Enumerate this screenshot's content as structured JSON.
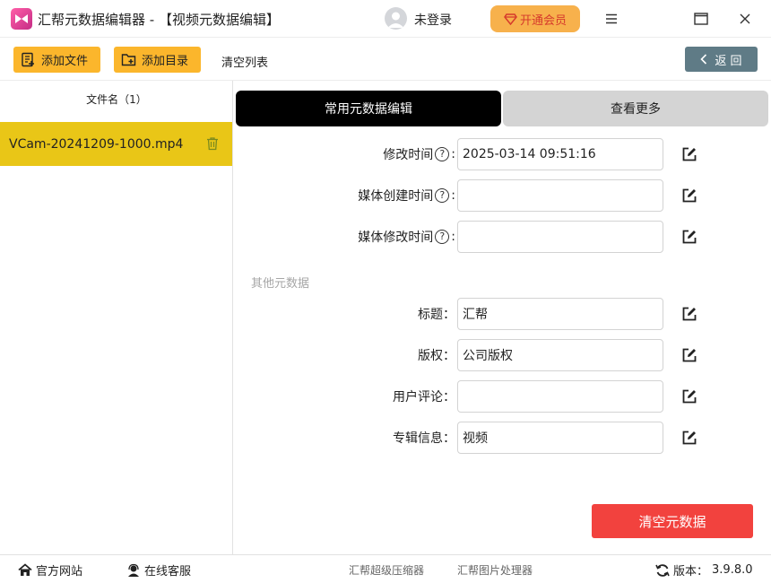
{
  "window": {
    "title": "汇帮元数据编辑器 - 【视频元数据编辑】",
    "user_label": "未登录",
    "vip_label": "开通会员"
  },
  "toolbar": {
    "add_file": "添加文件",
    "add_dir": "添加目录",
    "clear_list": "清空列表",
    "back": "返 回"
  },
  "file_list": {
    "header": "文件名（1）",
    "items": [
      {
        "name": "VCam-20241209-1000.mp4"
      }
    ]
  },
  "tabs": {
    "common": "常用元数据编辑",
    "more": "查看更多"
  },
  "fields": {
    "modified_time": {
      "label": "修改时间",
      "help": "?",
      "colon": ":",
      "value": "2025-03-14 09:51:16"
    },
    "media_created": {
      "label": "媒体创建时间",
      "help": "?",
      "colon": ":",
      "value": ""
    },
    "media_modified": {
      "label": "媒体修改时间",
      "help": "?",
      "colon": ":",
      "value": ""
    },
    "other_section": "其他元数据",
    "title": {
      "label": "标题：",
      "value": "汇帮"
    },
    "copyright": {
      "label": "版权：",
      "value": "公司版权"
    },
    "comment": {
      "label": "用户评论：",
      "value": ""
    },
    "album": {
      "label": "专辑信息：",
      "value": "视频"
    }
  },
  "actions": {
    "clear_metadata": "清空元数据"
  },
  "footer": {
    "website": "官方网站",
    "support": "在线客服",
    "compressor": "汇帮超级压缩器",
    "image_tool": "汇帮图片处理器",
    "version_label": "版本：",
    "version": "3.9.8.0"
  },
  "colors": {
    "accent_yellow": "#fbb62c",
    "selected_row": "#e9c617",
    "vip": "#f7b14c",
    "danger": "#f2423e",
    "back_button": "#5f7b86"
  }
}
